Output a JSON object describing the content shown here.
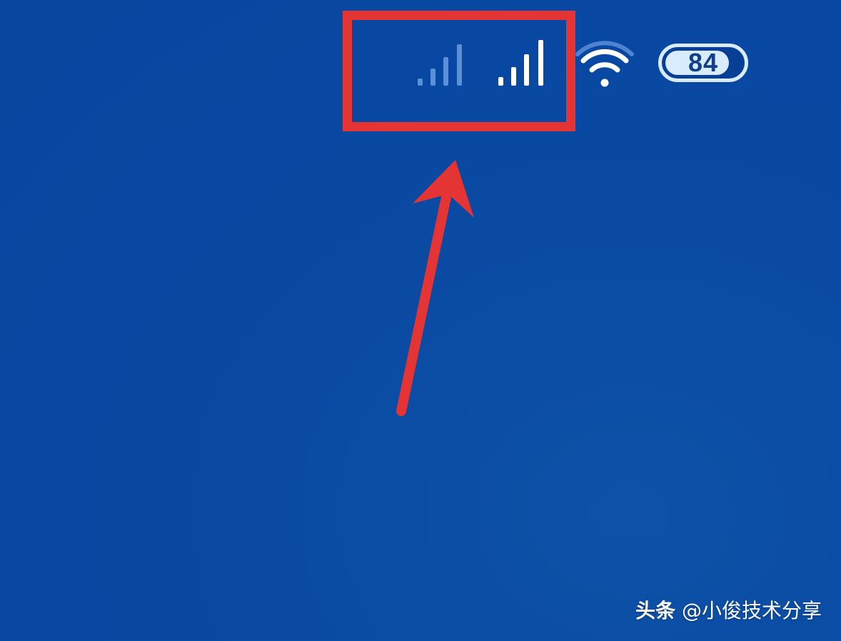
{
  "status_bar": {
    "sim1_signal": {
      "icon": "cellular-signal-icon",
      "level": 4,
      "max": 4,
      "state": "dimmed"
    },
    "sim2_signal": {
      "icon": "cellular-signal-icon",
      "level": 4,
      "max": 4,
      "state": "active"
    },
    "wifi": {
      "icon": "wifi-icon",
      "level": 3,
      "max": 3
    },
    "battery": {
      "icon": "battery-icon",
      "percent": "84",
      "fill_fraction": 0.84
    }
  },
  "annotation": {
    "box_color": "#e43434",
    "arrow_color": "#e43434"
  },
  "watermark": {
    "brand": "头条",
    "handle": "@小俊技术分享"
  },
  "colors": {
    "background": "#0a4aa3",
    "icon_active": "#ffffff",
    "icon_dim": "#5b8fd6"
  }
}
